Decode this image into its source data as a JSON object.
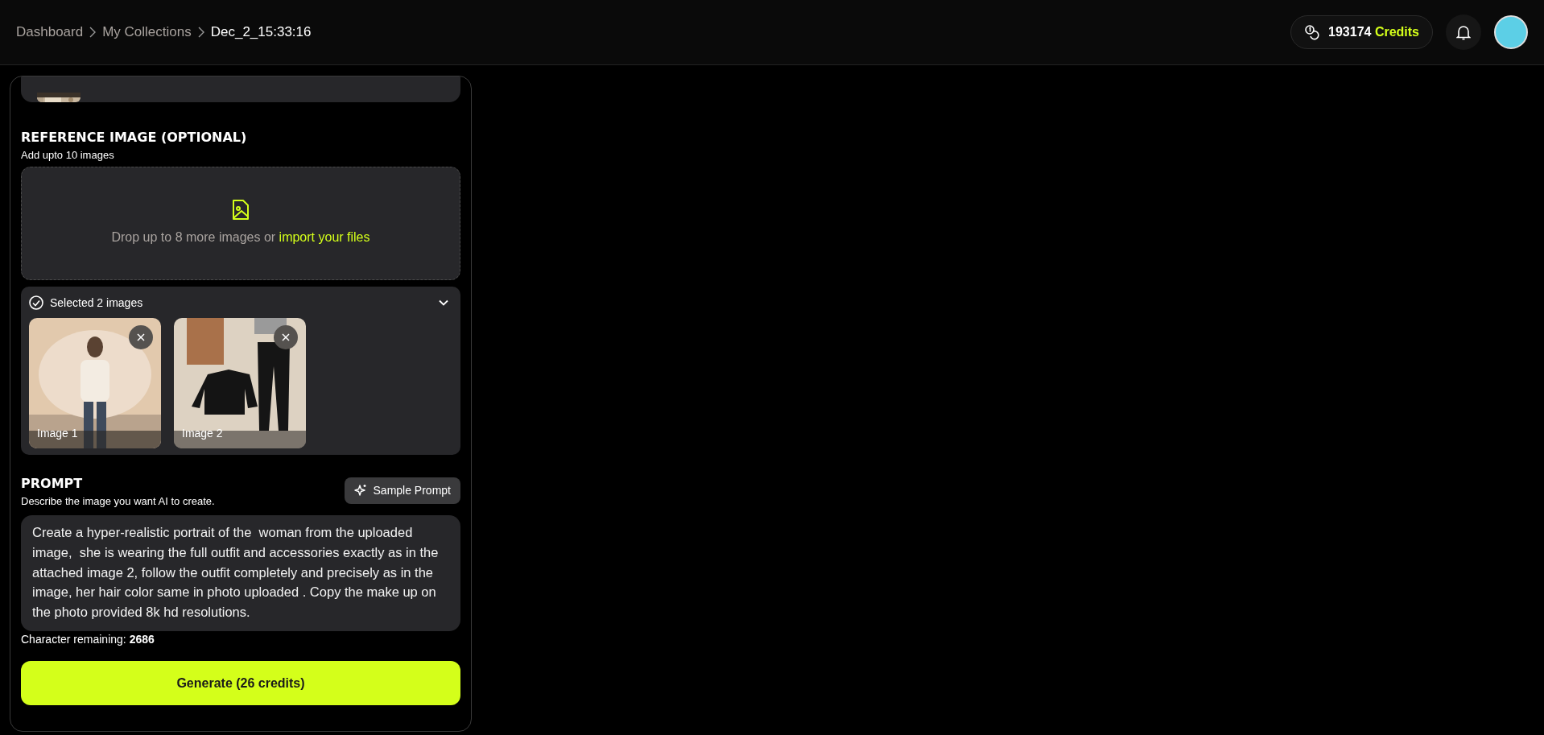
{
  "breadcrumbs": [
    {
      "label": "Dashboard",
      "current": false
    },
    {
      "label": "My Collections",
      "current": false
    },
    {
      "label": "Dec_2_15:33:16",
      "current": true
    }
  ],
  "header": {
    "credits_amount": "193174",
    "credits_label": "Credits"
  },
  "reference": {
    "title": "REFERENCE IMAGE (OPTIONAL)",
    "subtitle": "Add upto 10 images",
    "drop_text": "Drop up to 8 more images or ",
    "drop_link": "import your files"
  },
  "selected": {
    "label": "Selected 2 images",
    "expanded": true,
    "images": [
      {
        "label": "Image 1",
        "kind": "person"
      },
      {
        "label": "Image 2",
        "kind": "clothes"
      }
    ]
  },
  "prompt": {
    "title": "PROMPT",
    "subtitle": "Describe the image you want AI to create.",
    "sample_button": "Sample Prompt",
    "value": "Create a hyper-realistic portrait of the  woman from the uploaded image,  she is wearing the full outfit and accessories exactly as in the attached image 2, follow the outfit completely and precisely as in the image, her hair color same in photo uploaded . Copy the make up on the photo provided 8k hd resolutions.",
    "remaining_label": "Character remaining: ",
    "remaining_value": "2686"
  },
  "generate_button": "Generate (26 credits)"
}
